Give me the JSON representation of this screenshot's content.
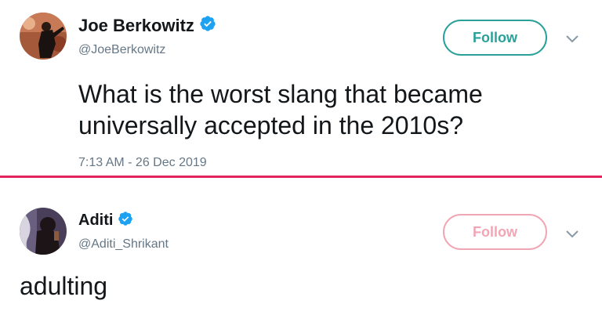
{
  "colors": {
    "divider": "#e0245e",
    "verified_badge": "#1da1f2",
    "follow_primary": "#2aa198",
    "follow_faded": "#f2a5b4"
  },
  "tweet1": {
    "name": "Joe Berkowitz",
    "handle": "@JoeBerkowitz",
    "follow_label": "Follow",
    "text_line1": "What is the worst slang that became",
    "text_line2": "universally accepted in the 2010s?",
    "timestamp": "7:13 AM - 26 Dec 2019",
    "verified_icon": "verified-badge-icon",
    "menu_icon": "chevron-down-icon"
  },
  "tweet2": {
    "name": "Aditi",
    "handle": "@Aditi_Shrikant",
    "follow_label": "Follow",
    "text": "adulting",
    "verified_icon": "verified-badge-icon",
    "menu_icon": "chevron-down-icon"
  }
}
